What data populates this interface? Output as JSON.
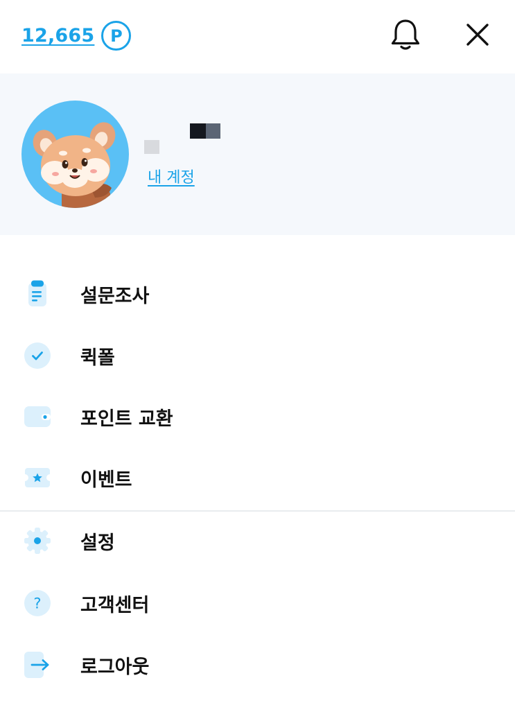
{
  "header": {
    "points_value": "12,665",
    "points_unit": "P",
    "bell_icon": "bell-icon",
    "close_icon": "close-icon"
  },
  "profile": {
    "avatar_icon": "red-panda-avatar",
    "account_link": "내 계정"
  },
  "menu": {
    "primary": [
      {
        "label": "설문조사",
        "icon": "survey-document-icon"
      },
      {
        "label": "퀵폴",
        "icon": "check-circle-icon"
      },
      {
        "label": "포인트 교환",
        "icon": "wallet-icon"
      },
      {
        "label": "이벤트",
        "icon": "star-ticket-icon"
      }
    ],
    "secondary": [
      {
        "label": "설정",
        "icon": "gear-icon"
      },
      {
        "label": "고객센터",
        "icon": "question-icon"
      },
      {
        "label": "로그아웃",
        "icon": "logout-arrow-icon"
      }
    ]
  },
  "colors": {
    "accent": "#1aa3e8",
    "icon_bg": "#dcf0fc",
    "profile_bg": "#f5f8fc",
    "avatar_bg": "#5ac0f5"
  }
}
